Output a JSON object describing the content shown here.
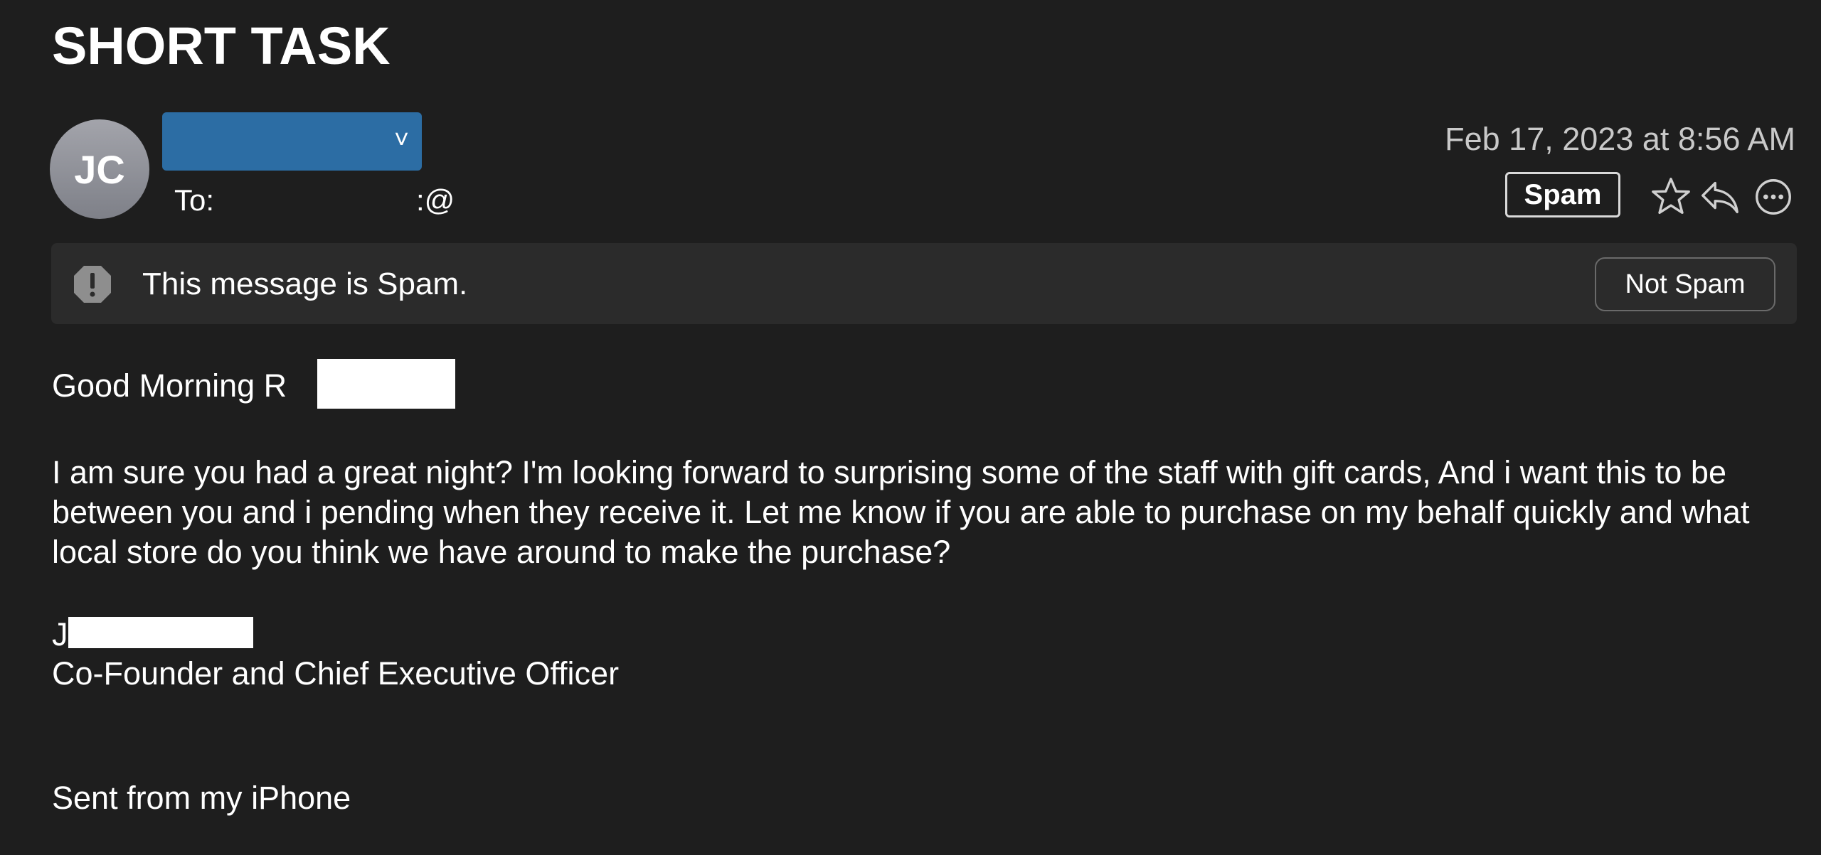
{
  "subject": "SHORT TASK",
  "sender": {
    "initials": "JC",
    "dropdown_glyph": "˅"
  },
  "recipient": {
    "label": "To:",
    "value": ":@"
  },
  "date": "Feb 17, 2023 at 8:56 AM",
  "header_tag": "Spam",
  "header_icons": [
    "star-icon",
    "reply-icon",
    "more-icon"
  ],
  "banner": {
    "icon": "exclamation-icon",
    "text": "This message is Spam.",
    "button_label": "Not Spam"
  },
  "body": {
    "greeting": "Good Morning R",
    "paragraph": "I am sure you had a great night? I'm looking forward to surprising some of the staff with gift cards, And i want this to be between you and i pending when they receive it. Let me know if you are able to purchase on my behalf quickly and what local store do you think we have around to make the purchase?",
    "signature_name": "J",
    "signature_title": "Co-Founder and Chief Executive Officer",
    "sent_from": "Sent from my iPhone"
  },
  "colors": {
    "background": "#1e1e1e",
    "banner_background": "#2b2b2b",
    "sender_highlight": "#2c6da4",
    "date_text": "#c9c9c9"
  }
}
